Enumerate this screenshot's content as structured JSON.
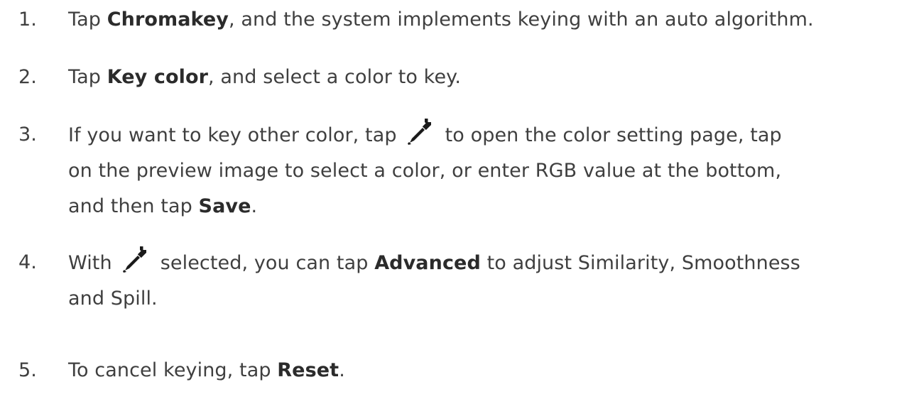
{
  "steps": [
    {
      "number": "1.",
      "before": "Tap ",
      "bold": "Chromakey",
      "after": ", and the system implements keying with an auto algorithm."
    },
    {
      "number": "2.",
      "before": "Tap ",
      "bold": "Key color",
      "after": ", and select a color to key."
    },
    {
      "number": "3.",
      "line1_before": "If you want to key other color, tap",
      "icon": "eyedropper-icon",
      "line1_after": "to open the color setting page, tap",
      "line2": "on the preview image to select a color, or enter RGB value at the bottom,",
      "line3_before": "and then tap ",
      "bold": "Save",
      "line3_after": "."
    },
    {
      "number": "4.",
      "line1_before": "With",
      "icon": "eyedropper-icon",
      "line1_mid": "selected, you can tap ",
      "bold": "Advanced",
      "line1_after": " to adjust Similarity, Smoothness",
      "line2": "and Spill."
    },
    {
      "number": "5.",
      "before": "To cancel keying, tap ",
      "bold": "Reset",
      "after": "."
    }
  ]
}
